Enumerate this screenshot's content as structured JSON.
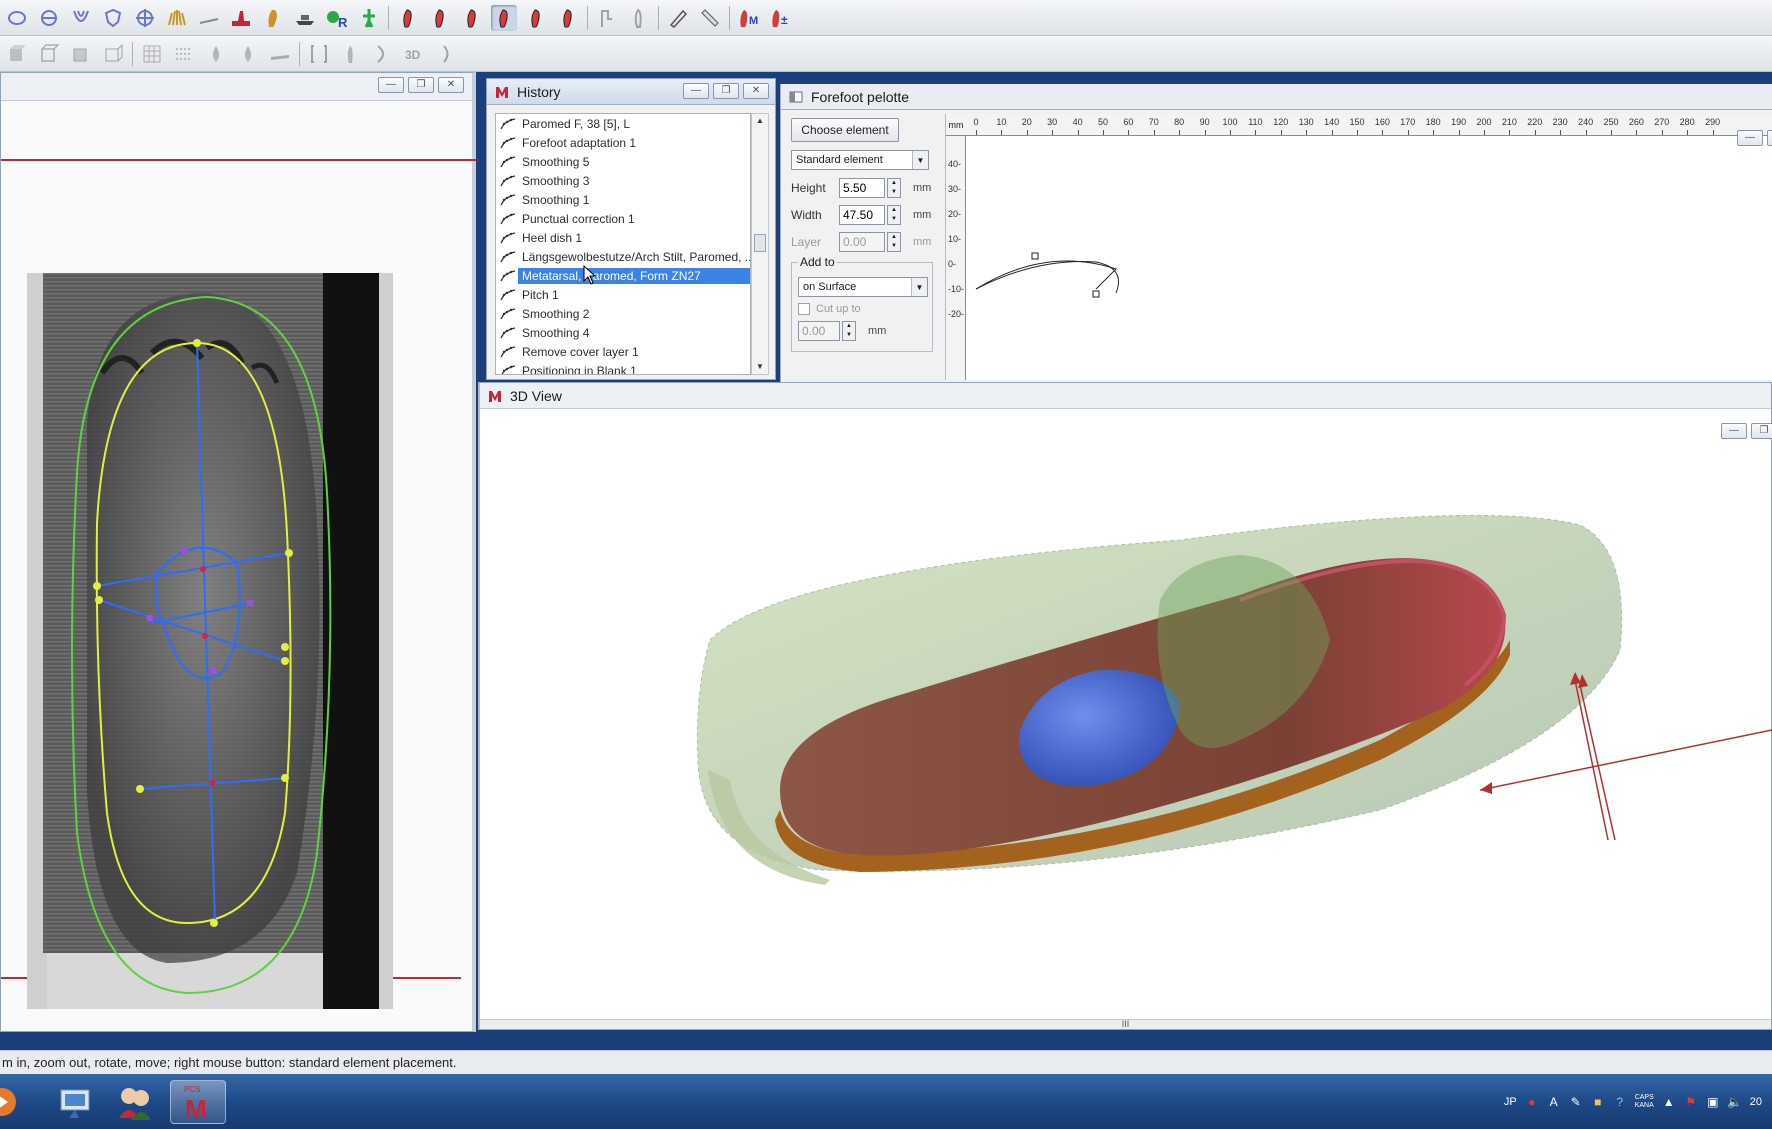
{
  "toolbar_primary": {
    "buttons": [
      {
        "name": "ellipse-tool-icon"
      },
      {
        "name": "circle-crosshair-icon"
      },
      {
        "name": "v-shape-icon"
      },
      {
        "name": "shield-outline-icon"
      },
      {
        "name": "globe-crosshair-icon"
      },
      {
        "name": "hands-icon"
      },
      {
        "name": "line-tool-icon"
      },
      {
        "name": "foot-scan-icon"
      },
      {
        "name": "foot-print-icon"
      },
      {
        "name": "ship-icon"
      },
      {
        "name": "green-r-icon",
        "label": "R"
      },
      {
        "name": "green-figure-icon"
      },
      {
        "name": "red-foot-1-icon"
      },
      {
        "name": "red-foot-2-icon"
      },
      {
        "name": "red-foot-3-icon"
      },
      {
        "name": "red-foot-4-icon"
      },
      {
        "name": "red-foot-5-icon"
      },
      {
        "name": "red-foot-6-icon"
      },
      {
        "name": "gray-foot-1-icon"
      },
      {
        "name": "gray-foot-2-icon"
      },
      {
        "name": "pen-tool-icon"
      },
      {
        "name": "ruler-tool-icon"
      },
      {
        "name": "red-m-icon",
        "label": "M"
      },
      {
        "name": "red-plus-minus-icon",
        "label": "±"
      }
    ]
  },
  "toolbar_secondary": {
    "buttons": [
      {
        "name": "cube-1-icon"
      },
      {
        "name": "cube-2-icon"
      },
      {
        "name": "cube-3-icon"
      },
      {
        "name": "cube-4-icon"
      },
      {
        "name": "grid-icon"
      },
      {
        "name": "dotted-grid-icon"
      },
      {
        "name": "drop-1-icon"
      },
      {
        "name": "drop-2-icon"
      },
      {
        "name": "flat-bar-icon"
      },
      {
        "name": "bracket-icon"
      },
      {
        "name": "foot-outline-icon"
      },
      {
        "name": "curve-icon"
      },
      {
        "name": "3d-icon",
        "label": "3D"
      },
      {
        "name": "bracket-2-icon"
      }
    ]
  },
  "history": {
    "title": "History",
    "items": [
      {
        "label": "Paromed F, 38     [5], L",
        "selected": false
      },
      {
        "label": "Forefoot adaptation 1",
        "selected": false
      },
      {
        "label": "Smoothing 5",
        "selected": false
      },
      {
        "label": "Smoothing 3",
        "selected": false
      },
      {
        "label": "Smoothing 1",
        "selected": false
      },
      {
        "label": "Punctual correction 1",
        "selected": false
      },
      {
        "label": "Heel dish 1",
        "selected": false
      },
      {
        "label": "Längsgewolbestutze/Arch Stilt, Paromed, ...",
        "selected": false
      },
      {
        "label": "Metatarsal, Paromed, Form ZN27",
        "selected": true
      },
      {
        "label": "Pitch 1",
        "selected": false
      },
      {
        "label": "Smoothing 2",
        "selected": false
      },
      {
        "label": "Smoothing 4",
        "selected": false
      },
      {
        "label": "Remove cover layer 1",
        "selected": false
      },
      {
        "label": "Positioning in Blank 1",
        "selected": false
      }
    ]
  },
  "pelotte": {
    "title": "Forefoot pelotte",
    "choose_button": "Choose element",
    "element_select": "Standard element",
    "height_label": "Height",
    "height_value": "5.50",
    "width_label": "Width",
    "width_value": "47.50",
    "layer_label": "Layer",
    "layer_value": "0.00",
    "unit": "mm",
    "add_to_label": "Add to",
    "add_to_select": "on Surface",
    "cut_up_label": "Cut up to",
    "cut_up_value": "0.00",
    "ruler_unit": "mm",
    "ruler_x_ticks": [
      "0",
      "10",
      "20",
      "30",
      "40",
      "50",
      "60",
      "70",
      "80",
      "90",
      "100",
      "110",
      "120",
      "130",
      "140",
      "150",
      "160",
      "170",
      "180",
      "190",
      "200",
      "210",
      "220",
      "230",
      "240",
      "250",
      "260",
      "270",
      "280",
      "290"
    ],
    "ruler_y_ticks": [
      "40-",
      "30-",
      "20-",
      "10-",
      "0-",
      "-10-",
      "-20-"
    ]
  },
  "view3d": {
    "title": "3D View",
    "splitter": "III"
  },
  "status_text": "m in, zoom out, rotate, move; right mouse button: standard element placement.",
  "taskbar": {
    "app_label": "PCS",
    "app_letter": "M",
    "tray_lang": "JP",
    "tray_caps": "CAPS",
    "tray_kana": "KANA",
    "tray_clock": "20"
  },
  "colors": {
    "accent_selection": "#3b84e6",
    "scan_outline_green": "#5fd13f",
    "scan_outline_yellow": "#e2ef3c",
    "scan_axis_blue": "#2d6cff",
    "insole_brown": "#8a4a3a",
    "pad_blue": "#4e6fd8"
  }
}
